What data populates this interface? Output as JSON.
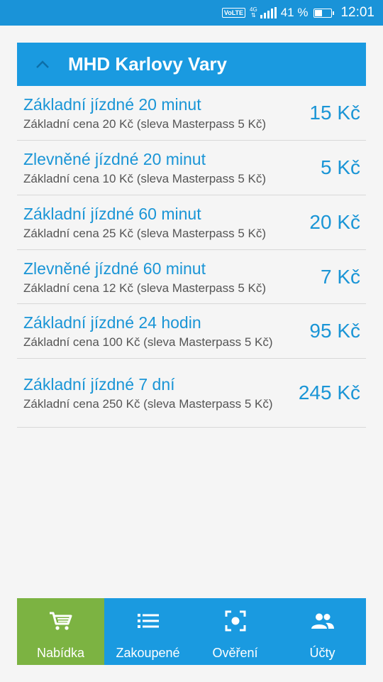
{
  "status_bar": {
    "volte": "VoLTE",
    "network": "4G",
    "battery_text": "41 %",
    "battery_level": 0.41,
    "time": "12:01"
  },
  "card": {
    "title": "MHD Karlovy Vary",
    "collapse_icon": "chevron-up-icon"
  },
  "tickets": [
    {
      "title": "Základní jízdné 20 minut",
      "subtitle": "Základní cena 20 Kč (sleva Masterpass 5 Kč)",
      "price": "15 Kč"
    },
    {
      "title": "Zlevněné jízdné 20 minut",
      "subtitle": "Základní cena 10 Kč (sleva Masterpass 5 Kč)",
      "price": "5 Kč"
    },
    {
      "title": "Základní jízdné 60 minut",
      "subtitle": "Základní cena 25 Kč (sleva Masterpass 5 Kč)",
      "price": "20 Kč"
    },
    {
      "title": "Zlevněné jízdné 60 minut",
      "subtitle": "Základní cena 12 Kč (sleva Masterpass 5 Kč)",
      "price": "7 Kč"
    },
    {
      "title": "Základní jízdné 24 hodin",
      "subtitle": "Základní cena 100 Kč (sleva Masterpass 5 Kč)",
      "price": "95 Kč"
    },
    {
      "title": "Základní jízdné 7 dní",
      "subtitle": "Základní cena 250 Kč (sleva Masterpass 5 Kč)",
      "price": "245 Kč"
    }
  ],
  "bottom_nav": [
    {
      "label": "Nabídka",
      "icon": "cart-icon",
      "active": true
    },
    {
      "label": "Zakoupené",
      "icon": "list-icon",
      "active": false
    },
    {
      "label": "Ověření",
      "icon": "qr-scan-icon",
      "active": false
    },
    {
      "label": "Účty",
      "icon": "people-icon",
      "active": false
    }
  ],
  "colors": {
    "primary": "#1a9ae0",
    "active_tab": "#7cb342",
    "status_bar": "#1a93d8"
  }
}
